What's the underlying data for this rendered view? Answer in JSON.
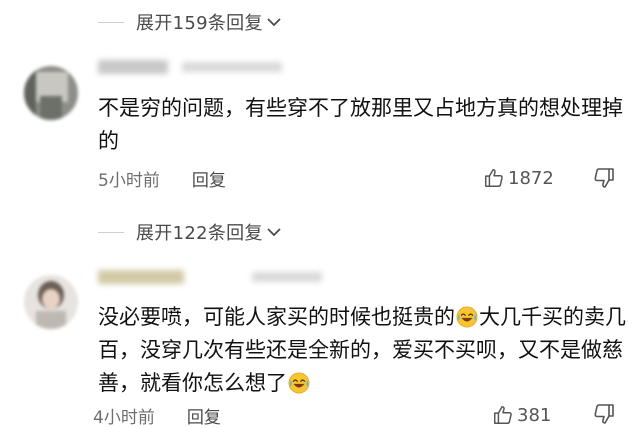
{
  "thread1": {
    "expand_text": "展开159条回复"
  },
  "comment1": {
    "text": "不是穷的问题，有些穿不了放那里又占地方真的想处理掉的",
    "time": "5小时前",
    "reply_label": "回复",
    "likes": "1872"
  },
  "thread2": {
    "expand_text": "展开122条回复"
  },
  "comment2": {
    "text_part1": "没必要喷，可能人家买的时候也挺贵的",
    "text_part2": "大几千买的卖几百，没穿几次有些还是全新的，爱买不买呗，又不是做慈善，就看你怎么想了",
    "time": "4小时前",
    "reply_label": "回复",
    "likes": "381"
  },
  "icons": {
    "expand": "chevron-down-icon",
    "like": "thumbs-up-icon",
    "dislike": "thumbs-down-icon",
    "emoji": "laughing-crying-emoji"
  },
  "colors": {
    "text": "#111111",
    "meta": "#6e6e6e",
    "expand": "#4a4a4a"
  }
}
